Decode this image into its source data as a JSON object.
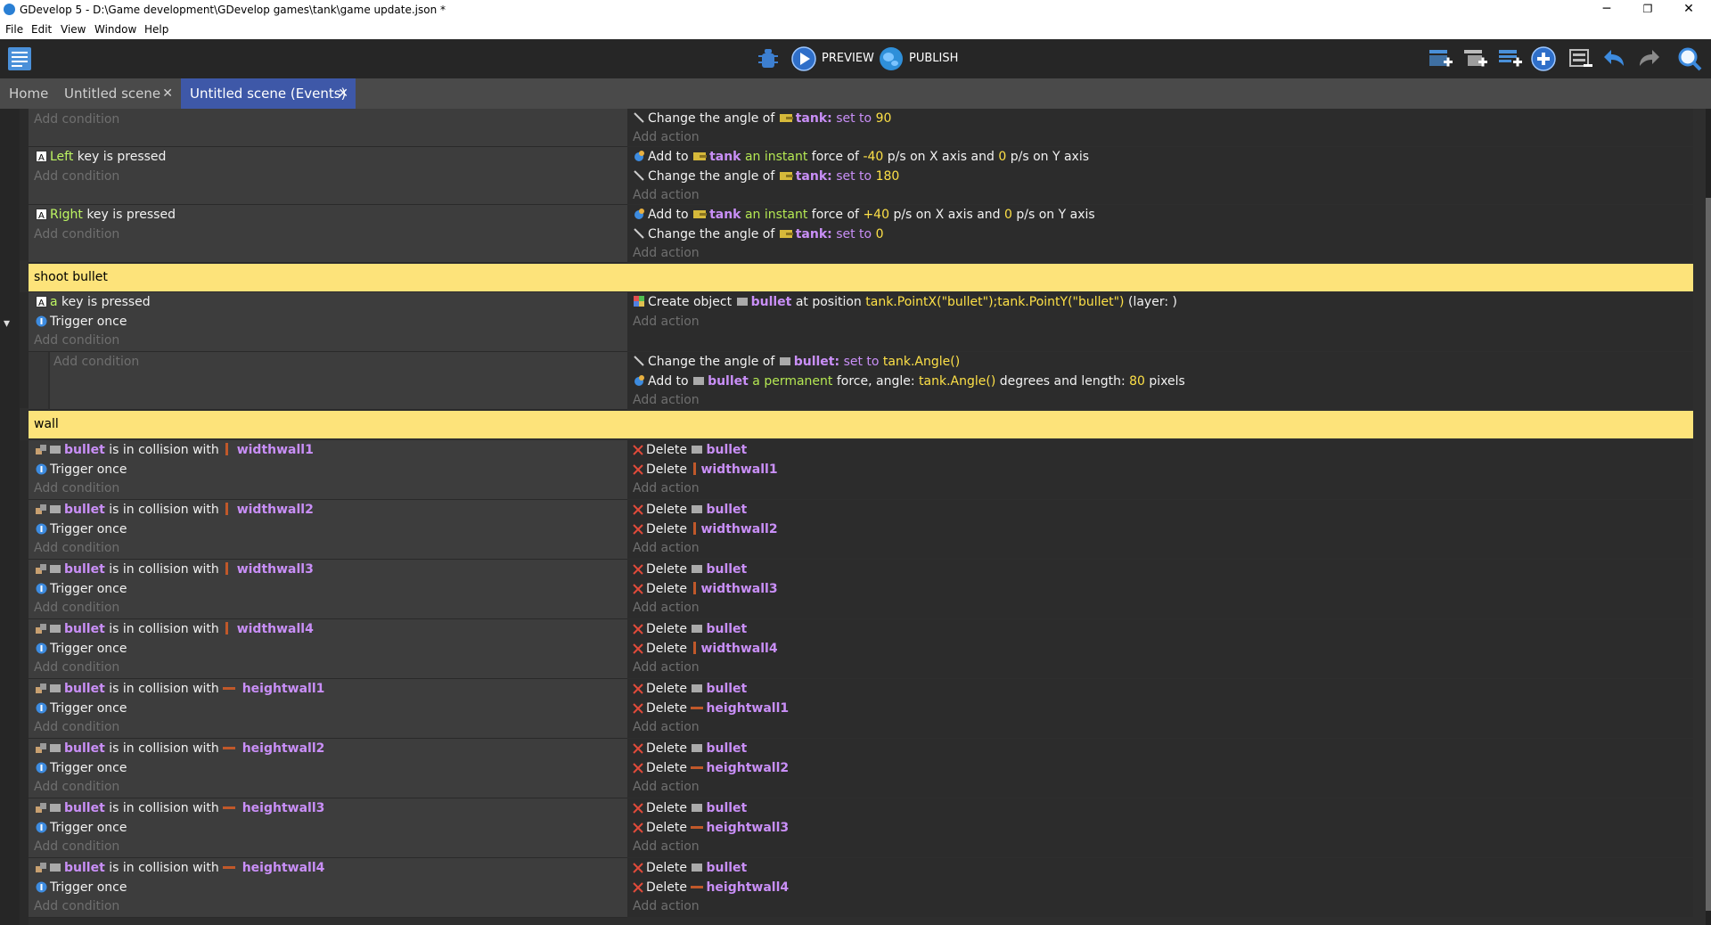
{
  "window": {
    "title": "GDevelop 5 - D:\\Game development\\GDevelop games\\tank\\game update.json *",
    "minimize": "─",
    "restore": "❐",
    "close": "✕"
  },
  "menu": [
    "File",
    "Edit",
    "View",
    "Window",
    "Help"
  ],
  "toolbar": {
    "preview_label": "PREVIEW",
    "publish_label": "PUBLISH"
  },
  "tabs": [
    {
      "label": "Home"
    },
    {
      "label": "Untitled scene"
    },
    {
      "label": "Untitled scene (Events)"
    }
  ],
  "tab_close": "✕",
  "common": {
    "add_condition": "Add condition",
    "add_action": "Add action",
    "trigger_once": "Trigger once",
    "collision": "is in collision with",
    "delete": "Delete",
    "key_is_pressed": "key is pressed",
    "change_angle": "Change the angle of",
    "set_to": "set to",
    "add_to": "Add to",
    "an_instant": "an instant",
    "force_of": "force of",
    "px_on_x": "p/s on X axis and",
    "px_on_y": "p/s on Y axis",
    "colon": ":",
    "caret": "▾"
  },
  "events": {
    "e1": {
      "obj": "tank",
      "val": "90"
    },
    "e2": {
      "key": "Left",
      "obj": "tank",
      "fx": "-40",
      "fy": "0",
      "angle": "180"
    },
    "e3": {
      "key": "Right",
      "obj": "tank",
      "fx": "+40",
      "fy": "0",
      "angle": "0"
    },
    "comment1": "shoot bullet",
    "e4": {
      "key": "a",
      "create": "Create object",
      "obj": "bullet",
      "at_pos": "at position",
      "pos": "tank.PointX(\"bullet\");tank.PointY(\"bullet\")",
      "layer": "(layer: )"
    },
    "e5": {
      "obj": "bullet",
      "angle_expr": "tank.Angle()",
      "permanent": "a permanent",
      "force_angle": "force, angle:",
      "degrees_len": "degrees and length:",
      "length": "80",
      "pixels": "pixels"
    },
    "comment2": "wall",
    "collisions": [
      {
        "a": "bullet",
        "b": "widthwall1"
      },
      {
        "a": "bullet",
        "b": "widthwall2"
      },
      {
        "a": "bullet",
        "b": "widthwall3"
      },
      {
        "a": "bullet",
        "b": "widthwall4"
      },
      {
        "a": "bullet",
        "b": "heightwall1"
      },
      {
        "a": "bullet",
        "b": "heightwall2"
      },
      {
        "a": "bullet",
        "b": "heightwall3"
      },
      {
        "a": "bullet",
        "b": "heightwall4"
      }
    ]
  },
  "colors": {
    "accent_tab": "#3e58a8",
    "comment": "#fde37a",
    "keyword": "#bdf562",
    "object": "#c98ff7",
    "number": "#fde047"
  }
}
